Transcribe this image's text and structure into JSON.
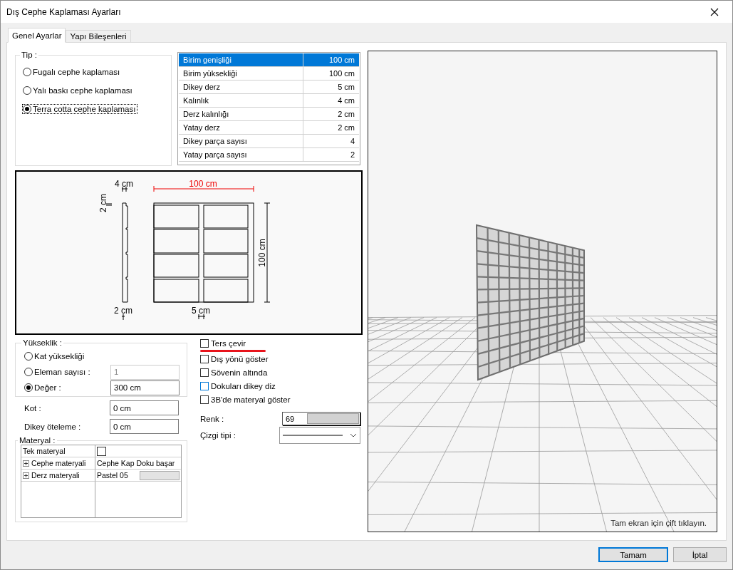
{
  "window": {
    "title": "Dış Cephe Kaplaması Ayarları"
  },
  "tabs": [
    {
      "label": "Genel Ayarlar",
      "selected": true
    },
    {
      "label": "Yapı Bileşenleri",
      "selected": false
    }
  ],
  "type_group": {
    "title": "Tip :",
    "options": [
      {
        "label": "Fugalı cephe kaplaması",
        "selected": false,
        "focused": false
      },
      {
        "label": "Yalı baskı cephe kaplaması",
        "selected": false,
        "focused": false
      },
      {
        "label": "Terra cotta cephe kaplaması",
        "selected": true,
        "focused": true
      }
    ]
  },
  "properties": [
    {
      "name": "Birim genişliği",
      "value": "100 cm",
      "selected": true
    },
    {
      "name": "Birim yüksekliği",
      "value": "100 cm",
      "selected": false
    },
    {
      "name": "Dikey derz",
      "value": "5 cm",
      "selected": false
    },
    {
      "name": "Kalınlık",
      "value": "4 cm",
      "selected": false
    },
    {
      "name": "Derz kalınlığı",
      "value": "2 cm",
      "selected": false
    },
    {
      "name": "Yatay derz",
      "value": "2 cm",
      "selected": false
    },
    {
      "name": "Dikey parça sayısı",
      "value": "4",
      "selected": false
    },
    {
      "name": "Yatay parça sayısı",
      "value": "2",
      "selected": false
    }
  ],
  "section_drawing": {
    "thickness_label": "4 cm",
    "width_label": "100 cm",
    "joint_label": "2 cm",
    "height_label": "100 cm",
    "bottom_joint_label": "2 cm",
    "vertical_joint_label": "5 cm"
  },
  "height_group": {
    "title": "Yükseklik :",
    "options": [
      {
        "label": "Kat yüksekliği",
        "selected": false
      },
      {
        "label": "Eleman sayısı  :",
        "selected": false,
        "value": "1",
        "disabled": true
      },
      {
        "label": "Değer :",
        "selected": true,
        "value": "300 cm",
        "disabled": false
      }
    ]
  },
  "fields": [
    {
      "label": "Kot :",
      "value": "0 cm"
    },
    {
      "label": "Dikey öteleme :",
      "value": "0 cm"
    }
  ],
  "material_group": {
    "title": "Materyal :",
    "rows": [
      {
        "name": "Tek materyal",
        "kind": "checkbox",
        "checked": false
      },
      {
        "name": "Cephe materyali",
        "kind": "texture",
        "value": "Cephe Kap",
        "value_2": "Doku başar"
      },
      {
        "name": "Derz materyali",
        "kind": "swatch",
        "value": "Pastel 05"
      }
    ]
  },
  "options": [
    {
      "label": "Ters çevir",
      "checked": false,
      "focused": false,
      "underlined": true
    },
    {
      "label": "Dış yönü göster",
      "checked": false,
      "focused": false,
      "underlined": false
    },
    {
      "label": "Sövenin altında",
      "checked": false,
      "focused": false,
      "underlined": false
    },
    {
      "label": "Dokuları dikey diz",
      "checked": false,
      "focused": true,
      "underlined": false
    },
    {
      "label": "3B'de materyal göster",
      "checked": false,
      "focused": false,
      "underlined": false
    }
  ],
  "color_field": {
    "label": "Renk :",
    "value": "69"
  },
  "line_type": {
    "label": "Çizgi tipi :"
  },
  "viewport": {
    "hint": "Tam ekran için çift tıklayın."
  },
  "buttons": [
    {
      "label": "Tamam",
      "default": true
    },
    {
      "label": "İptal",
      "default": false
    }
  ]
}
